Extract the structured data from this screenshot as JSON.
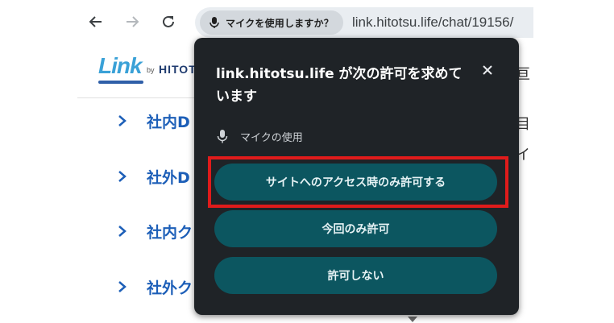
{
  "browser": {
    "back_icon": "arrow-left-icon",
    "forward_icon": "arrow-right-icon",
    "reload_icon": "reload-icon",
    "mic_chip_label": "マイクを使用しますか？",
    "url": "link.hitotsu.life/chat/19156/"
  },
  "page": {
    "logo": {
      "name": "Link",
      "by": "by",
      "company": "HITOT"
    },
    "menu": [
      {
        "label": "社内D"
      },
      {
        "label": "社外D"
      },
      {
        "label": "社内ク"
      },
      {
        "label": "社外ク"
      }
    ],
    "right_fragments": [
      "亘",
      "目",
      "イ"
    ]
  },
  "popup": {
    "title": "link.hitotsu.life が次の許可を求めています",
    "permission_label": "マイクの使用",
    "buttons": {
      "allow_while_visiting": "サイトへのアクセス時のみ許可する",
      "allow_this_time": "今回のみ許可",
      "deny": "許可しない"
    }
  },
  "colors": {
    "popup_bg": "#1f2327",
    "button_bg": "#0c5660",
    "highlight": "#e01b1b",
    "menu_text": "#1d5fb8"
  }
}
